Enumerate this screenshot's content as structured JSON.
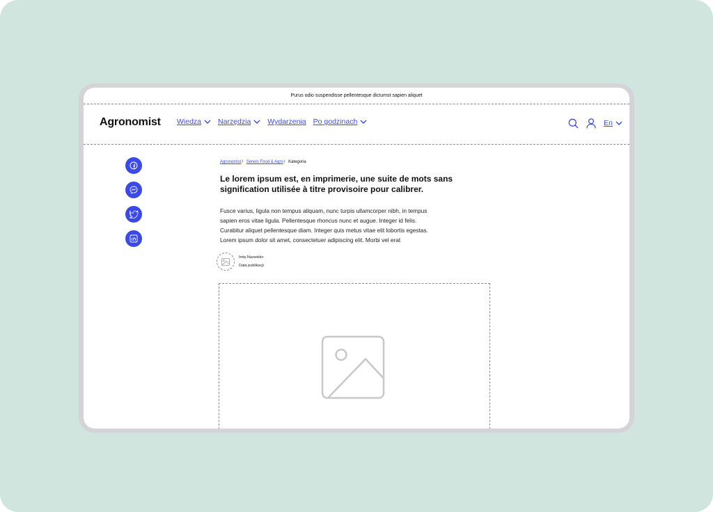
{
  "announcement": "Purus odio suspendisse pellentesque dictumst sapien aliquet",
  "header": {
    "logo": "Agronomist",
    "nav": [
      {
        "label": "Wiedza",
        "dropdown": true
      },
      {
        "label": "Narzędzia",
        "dropdown": true
      },
      {
        "label": "Wydarzenia",
        "dropdown": false
      },
      {
        "label": "Po godzinach",
        "dropdown": true
      }
    ],
    "language": "En",
    "icons": [
      "search-icon",
      "user-icon"
    ]
  },
  "social": [
    "facebook-icon",
    "messenger-icon",
    "twitter-icon",
    "linkedin-icon"
  ],
  "breadcrumb": {
    "items": [
      "Agronomist",
      "Serwis Food & Agro"
    ],
    "separator": "/",
    "current": "Kategoria"
  },
  "article": {
    "title": "Le lorem ipsum est, en imprimerie, une suite de mots sans signification utilisée à titre provisoire pour calibrer.",
    "lines": [
      "Fusce varius, ligula non tempus aliquam, nunc turpis ullamcorper nibh, in tempus",
      "sapien eros vitae ligula. Pellentesque rhoncus nunc et augue. Integer id felis.",
      "Curabitur aliquet pellentesque diam. Integer quis metus vitae elit lobortis egestas.",
      "Lorem ipsum dolor sit amet, consectetuer adipiscing elit. Morbi vel erat"
    ],
    "author_name": "Imię.Nazwisko",
    "publish_date": "Data publikacji"
  },
  "colors": {
    "accent": "#3b4ae6",
    "background": "#cfe5dd",
    "frame": "#d4d4d6"
  }
}
